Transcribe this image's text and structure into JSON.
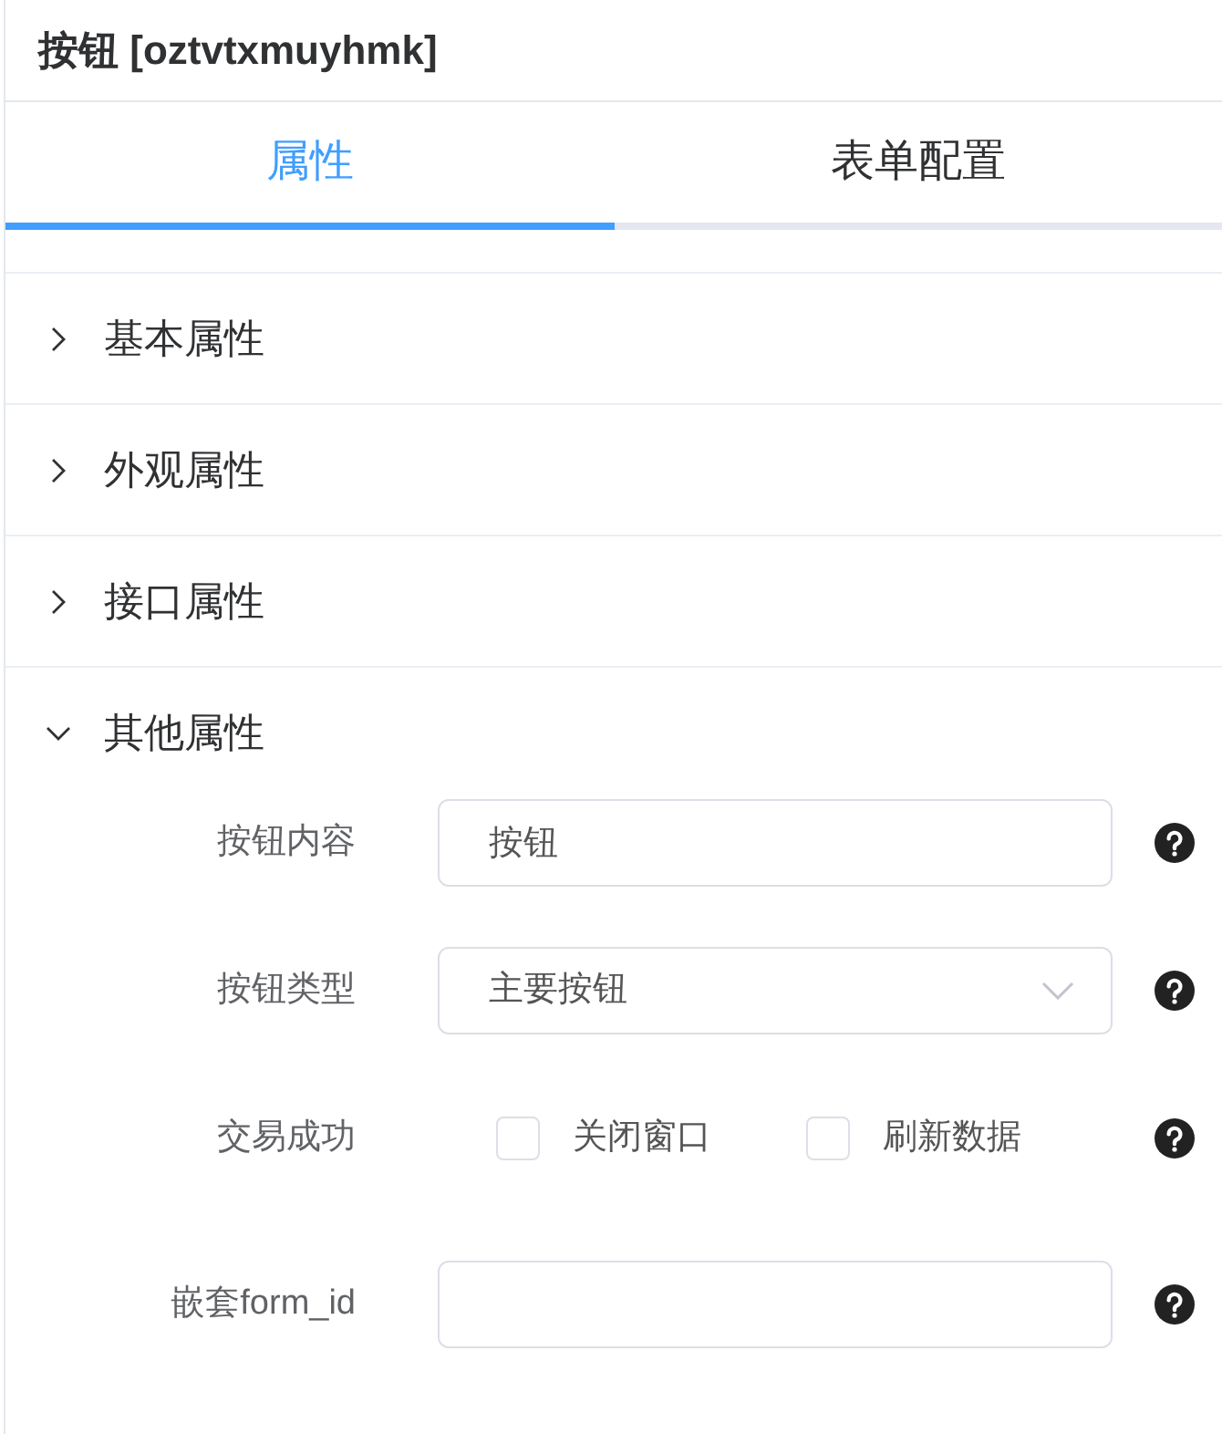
{
  "panel": {
    "title": "按钮 [oztvtxmuyhmk]"
  },
  "tabs": [
    {
      "label": "属性",
      "selected": true
    },
    {
      "label": "表单配置",
      "selected": false
    }
  ],
  "sections": [
    {
      "title": "基本属性",
      "expanded": false
    },
    {
      "title": "外观属性",
      "expanded": false
    },
    {
      "title": "接口属性",
      "expanded": false
    },
    {
      "title": "其他属性",
      "expanded": true,
      "fields": [
        {
          "kind": "input",
          "label": "按钮内容",
          "value": "按钮"
        },
        {
          "kind": "select",
          "label": "按钮类型",
          "value": "主要按钮"
        },
        {
          "kind": "checkboxes",
          "label": "交易成功",
          "options": [
            {
              "label": "关闭窗口",
              "checked": false
            },
            {
              "label": "刷新数据",
              "checked": false
            }
          ]
        },
        {
          "kind": "input",
          "label": "嵌套form_id"
        }
      ]
    }
  ]
}
